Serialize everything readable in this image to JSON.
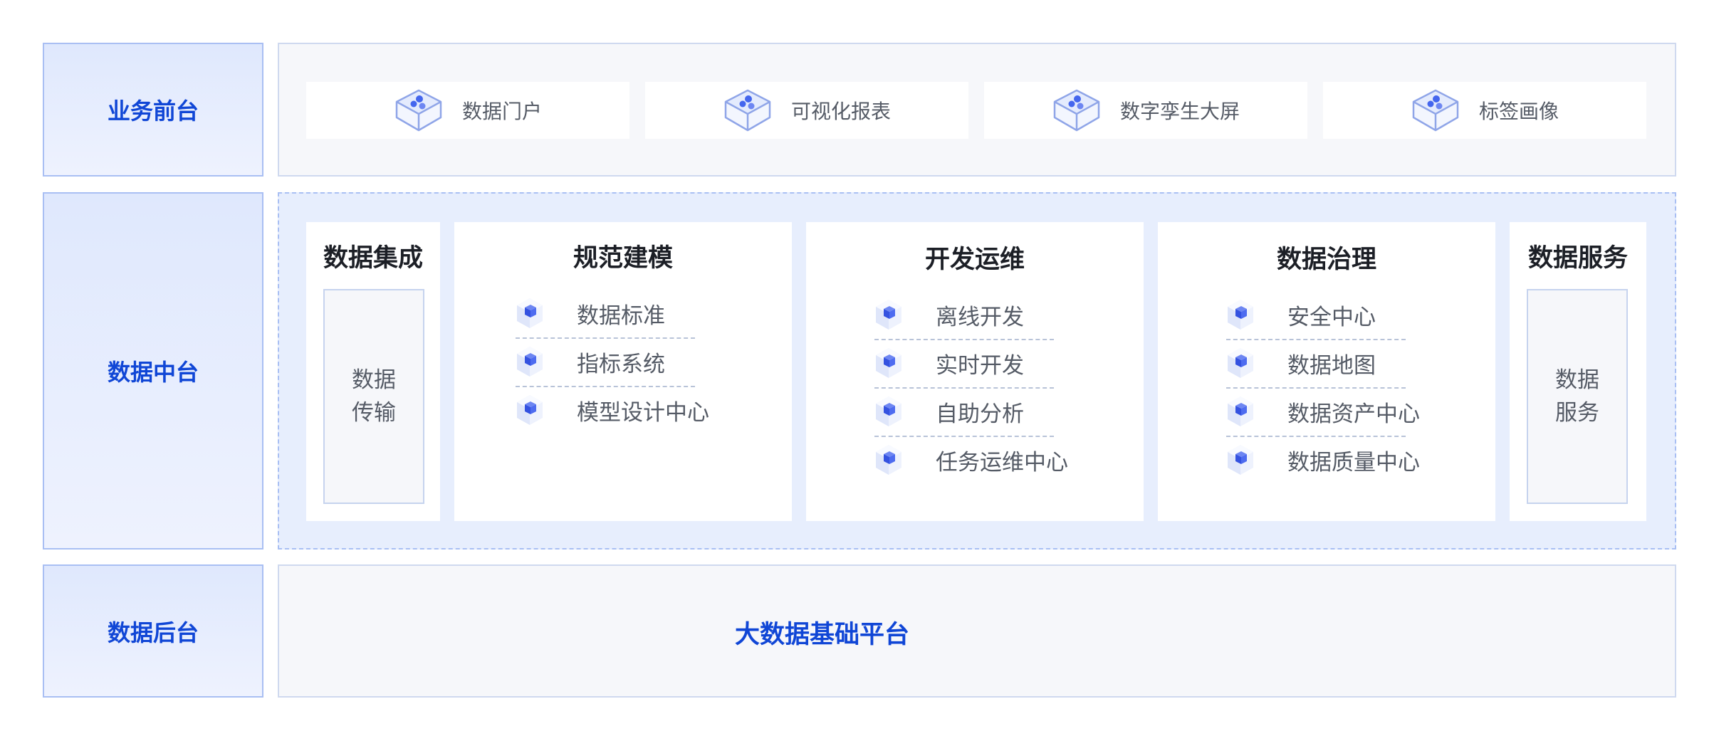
{
  "layers": {
    "front": "业务前台",
    "middle": "数据中台",
    "back": "数据后台"
  },
  "front_apps": [
    {
      "label": "数据门户",
      "icon": "data-box-icon"
    },
    {
      "label": "可视化报表",
      "icon": "data-box-icon"
    },
    {
      "label": "数字孪生大屏",
      "icon": "data-box-icon"
    },
    {
      "label": "标签画像",
      "icon": "data-box-icon"
    }
  ],
  "modules": {
    "integration": {
      "title": "数据集成",
      "box_line1": "数据",
      "box_line2": "传输"
    },
    "modeling": {
      "title": "规范建模",
      "items": [
        "数据标准",
        "指标系统",
        "模型设计中心"
      ]
    },
    "devops": {
      "title": "开发运维",
      "items": [
        "离线开发",
        "实时开发",
        "自助分析",
        "任务运维中心"
      ]
    },
    "governance": {
      "title": "数据治理",
      "items": [
        "安全中心",
        "数据地图",
        "数据资产中心",
        "数据质量中心"
      ]
    },
    "service": {
      "title": "数据服务",
      "box_line1": "数据",
      "box_line2": "服务"
    }
  },
  "platform": {
    "title": "大数据基础平台"
  },
  "colors": {
    "accent": "#1046d6",
    "panel_border": "#a9bff3",
    "icon_blue": "#3d5ce6"
  }
}
